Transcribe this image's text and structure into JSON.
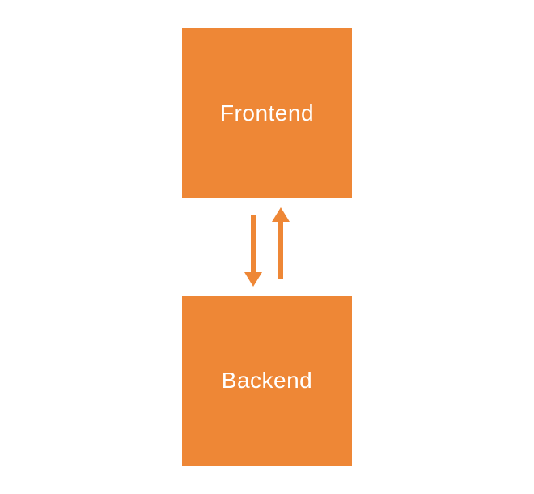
{
  "diagram": {
    "colors": {
      "box": "#ee8736",
      "arrow": "#ee8736",
      "text": "#ffffff"
    },
    "top_box": {
      "label": "Frontend"
    },
    "bottom_box": {
      "label": "Backend"
    }
  }
}
